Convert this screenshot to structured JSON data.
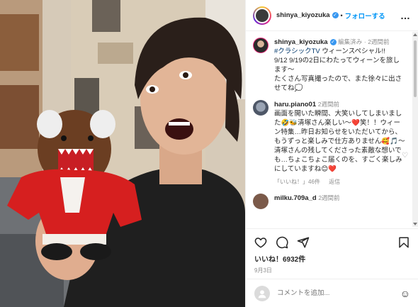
{
  "header": {
    "username": "shinya_kiyozuka",
    "follow_label": "フォローする",
    "dot": "•",
    "more": "…"
  },
  "caption": {
    "username": "shinya_kiyozuka",
    "edited": "編集済み",
    "time": "2週間前",
    "hashtag": "#クラシックTV",
    "line1": " ウィーンスペシャル!!",
    "line2": "9/12 9/19の2日にわたってウィーンを旅します〜",
    "line3": "たくさん写真撮ったので、また徐々に出させてね💭"
  },
  "comment": {
    "username": "haru.piano01",
    "time": "2週間前",
    "text": "画面を開いた瞬間、大笑いしてしまいました🤣🐝清塚さん楽しい〜❤️笑！！ウィーン特集…昨日お知らせをいただいてから、もうずっと楽しみで仕方ありません🥰🎵〜清塚さんの残してくださった素敵な想いでも…ちょこちょこ届くのを、すごく楽しみにしていますね😊❤️",
    "likes": "「いいね！」46件",
    "reply": "返信"
  },
  "next_comment": {
    "username": "milku.709a_d",
    "time": "2週間前"
  },
  "actions": {
    "likes": "いいね！6932件",
    "date": "9月3日"
  },
  "add_comment": {
    "placeholder": "コメントを追加..."
  },
  "colors": {
    "link_blue": "#0095f6",
    "verified_blue": "#3897f0",
    "muted": "#8e8e8e"
  }
}
